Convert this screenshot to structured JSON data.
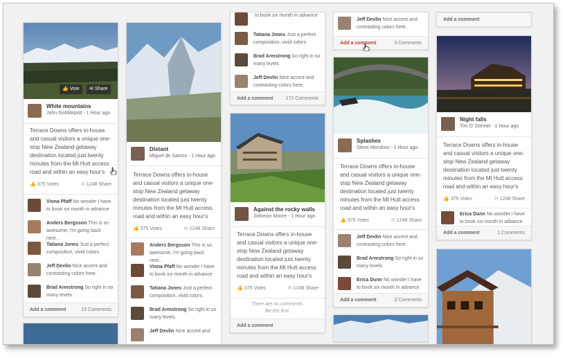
{
  "colors": {
    "accent_red": "#c0392b",
    "background": "#f1f1f1",
    "card": "#ffffff"
  },
  "column1": {
    "card1": {
      "photo_buttons": {
        "vote": "Vote",
        "share": "Share"
      },
      "title": "White mountains",
      "meta": "John Gobblepott - 1 Hour ago",
      "description": "Terrace Downs offers in-house and casual visitors a unique one-stop New Zealand getaway destination located just twenty minutes from the Mt Hutt access road and within an easy hour's",
      "votes": "375 Votes",
      "shares": "1248 Share",
      "comments": [
        {
          "name": "Viona Pfaff",
          "text": "No wonder I have to book six month in advance"
        },
        {
          "name": "Anders Bergsson",
          "text": "This is so awesome, I'm going back next..."
        },
        {
          "name": "Tatiana Jones",
          "text": "Just a perfect composition, vivid colors."
        },
        {
          "name": "Jeff Devlin",
          "text": "Nice accent and contrasting colors here."
        },
        {
          "name": "Brad Armstrong",
          "text": "So right in so many levels"
        }
      ],
      "add_comment": "Add a comment",
      "comment_count": "15 Comments"
    }
  },
  "column2": {
    "card1": {
      "title": "Distant",
      "meta": "Miguel de Santos - 1 Hour ago",
      "description": "Terrace Downs offers in-house and casual visitors a unique one-stop New Zealand getaway destination located just twenty minutes from the Mt Hutt access road and within an easy hour's",
      "votes": "375 Votes",
      "shares": "1248 Share",
      "comments": [
        {
          "name": "Anders Bergsson",
          "text": "This is so awesome, I'm going back next..."
        },
        {
          "name": "Viona Pfaff",
          "text": "No wonder I have to book six month in advance"
        },
        {
          "name": "Tatiana Jones",
          "text": "Just a perfect composition, vivid colors."
        },
        {
          "name": "Brad Armstrong",
          "text": "So right in so many levels"
        },
        {
          "name": "Jeff Devlin",
          "text": "Nice accent and"
        }
      ]
    }
  },
  "column3": {
    "card1": {
      "comments": [
        {
          "name": "",
          "text": "to book six month in advance"
        },
        {
          "name": "Tatiana Jones",
          "text": "Just a perfect composition, vivid colors."
        },
        {
          "name": "Brad Armstrong",
          "text": "So right in so many levels"
        },
        {
          "name": "Jeff Devlin",
          "text": "Nice accent and contrasting colors here."
        }
      ],
      "add_comment": "Add a comment",
      "comment_count": "172 Comments"
    },
    "card2": {
      "title": "Against the rocky walls",
      "meta": "Johnson Moore - 1 Hour ago",
      "description": "Terrace Downs offers in-house and casual visitors a unique one-stop New Zealand getaway destination located just twenty minutes from the Mt Hutt access road and within an easy hour's",
      "votes": "375 Votes",
      "shares": "1248 Share",
      "no_comments_line1": "There are no comments.",
      "no_comments_line2": "Be the first.",
      "add_comment": "Add a comment"
    }
  },
  "column4": {
    "card1": {
      "comments": [
        {
          "name": "Jeff Devlin",
          "text": "Nice accent and contrasting colors here."
        }
      ],
      "add_comment": "Add a comment",
      "comment_count": "3 Comments"
    },
    "card2": {
      "title": "Splashes",
      "meta": "Steve Monduro - 1 Hour ago",
      "description": "Terrace Downs offers in-house and casual visitors a unique one-stop New Zealand getaway destination located just twenty minutes from the Mt Hutt access road and within an easy hour's",
      "votes": "375 Votes",
      "shares": "1248 Share",
      "comments": [
        {
          "name": "Jeff Devlin",
          "text": "Nice accent and contrasting colors here."
        },
        {
          "name": "Brad Armstrong",
          "text": "So right in so many levels"
        },
        {
          "name": "Erica Dunn",
          "text": "No wonder I have to book six month in advance"
        }
      ],
      "add_comment": "Add a comment",
      "comment_count": "3 Comments"
    }
  },
  "column5": {
    "card1": {
      "add_comment": "Add a comment"
    },
    "card2": {
      "title": "Night falls",
      "meta": "Tim O' Donnel - 1 Hour ago",
      "description": "Terrace Downs offers in-house and casual visitors a unique one-stop New Zealand getaway destination located just twenty minutes from the Mt Hutt access road and within an easy hour's",
      "votes": "375 Votes",
      "shares": "1248 Share",
      "comments": [
        {
          "name": "Erica Dunn",
          "text": "No wonder I have to book six month in advance"
        }
      ],
      "add_comment": "Add a comment",
      "comment_count": "1 Comments"
    }
  }
}
